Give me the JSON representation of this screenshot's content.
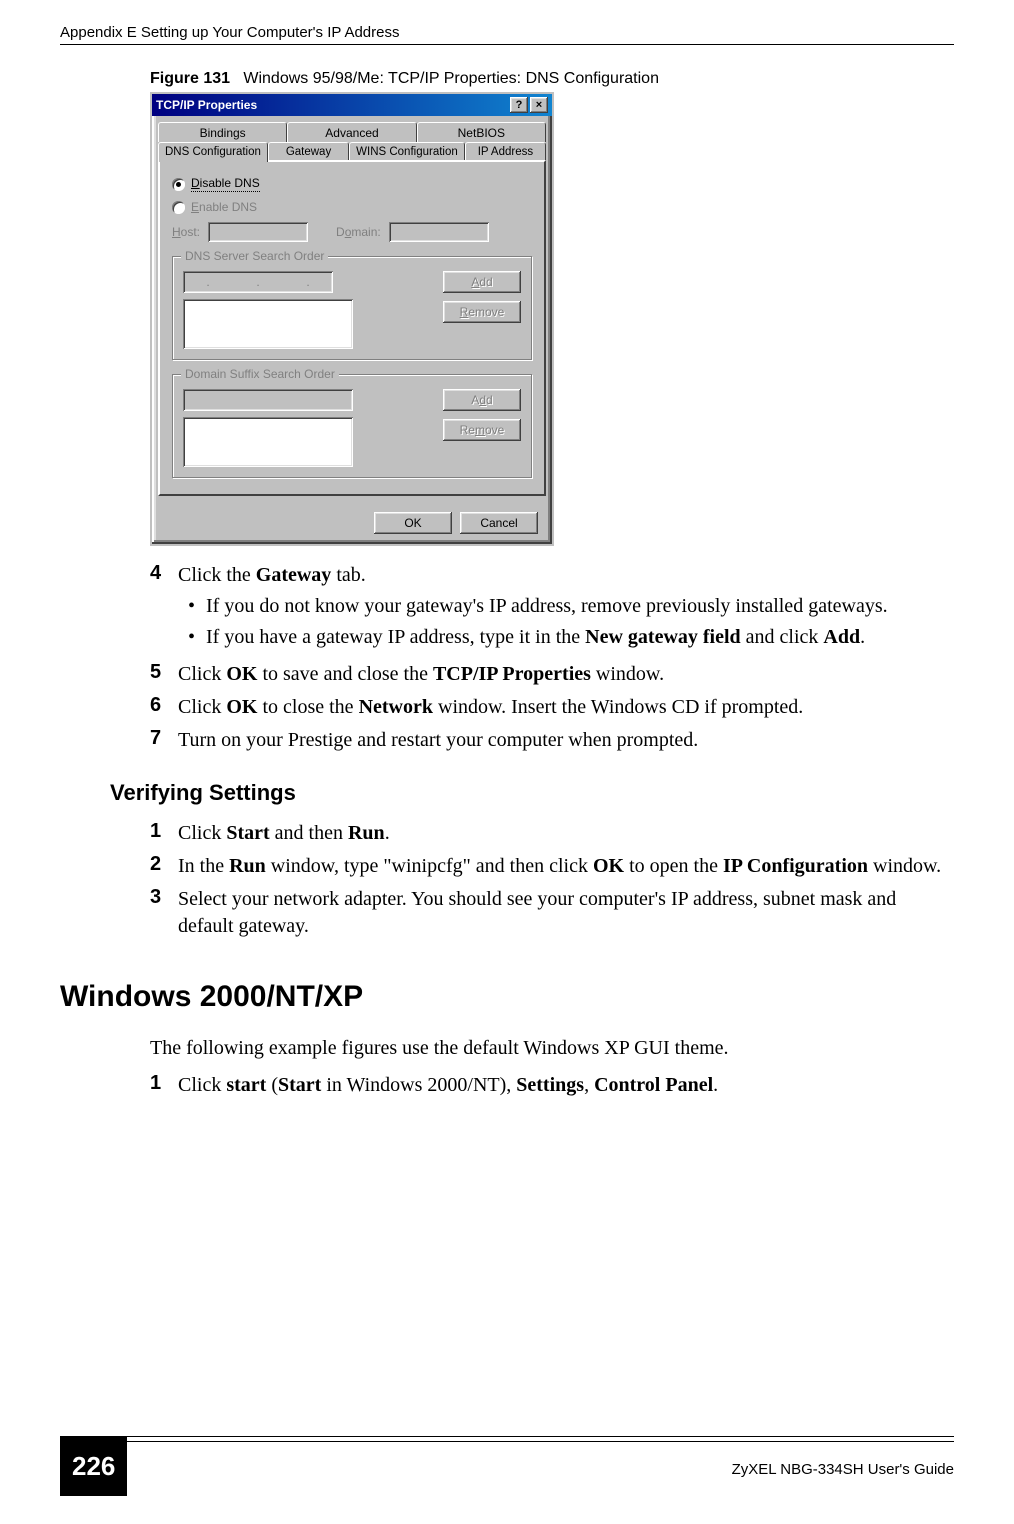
{
  "header": {
    "title": "Appendix E Setting up Your Computer's IP Address"
  },
  "figure": {
    "label": "Figure 131",
    "caption": "Windows 95/98/Me: TCP/IP Properties: DNS Configuration"
  },
  "dialog": {
    "title": "TCP/IP Properties",
    "help_glyph": "?",
    "close_glyph": "×",
    "tabs_row1": [
      "Bindings",
      "Advanced",
      "NetBIOS"
    ],
    "tabs_row2": [
      "DNS Configuration",
      "Gateway",
      "WINS Configuration",
      "IP Address"
    ],
    "active_tab": "DNS Configuration",
    "radio_disable": "Disable DNS",
    "radio_enable": "Enable DNS",
    "host_label": "Host:",
    "domain_label": "Domain:",
    "group_dns": "DNS Server Search Order",
    "group_suffix": "Domain Suffix Search Order",
    "btn_add": "Add",
    "btn_remove": "Remove",
    "btn_ok": "OK",
    "btn_cancel": "Cancel"
  },
  "steps_a": {
    "s4": "Click the ",
    "s4_b": "Gateway",
    "s4_end": " tab.",
    "s4_sub1": "If you do not know your gateway's IP address, remove previously installed gateways.",
    "s4_sub2a": "If you have a gateway IP address, type it in the ",
    "s4_sub2b": "New gateway field",
    "s4_sub2c": " and click ",
    "s4_sub2d": "Add",
    "s4_sub2e": ".",
    "s5a": "Click ",
    "s5b": "OK",
    "s5c": " to save and close the ",
    "s5d": "TCP/IP Properties",
    "s5e": " window.",
    "s6a": "Click ",
    "s6b": "OK",
    "s6c": " to close the ",
    "s6d": "Network",
    "s6e": " window. Insert the Windows CD if prompted.",
    "s7": "Turn on your Prestige and restart your computer when prompted."
  },
  "verify_heading": "Verifying Settings",
  "steps_b": {
    "s1a": "Click ",
    "s1b": "Start",
    "s1c": " and then ",
    "s1d": "Run",
    "s1e": ".",
    "s2a": "In the ",
    "s2b": "Run",
    "s2c": " window, type \"winipcfg\" and then click ",
    "s2d": "OK",
    "s2e": " to open the ",
    "s2f": "IP Configuration",
    "s2g": " window.",
    "s3": "Select your network adapter. You should see your computer's IP address, subnet mask and default gateway."
  },
  "section_heading": "Windows 2000/NT/XP",
  "section_para": "The following example figures use the default Windows XP GUI theme.",
  "steps_c": {
    "s1a": "Click ",
    "s1b": "start",
    "s1c": " (",
    "s1d": "Start",
    "s1e": " in Windows 2000/NT), ",
    "s1f": "Settings",
    "s1g": ", ",
    "s1h": "Control Panel",
    "s1i": "."
  },
  "footer": {
    "page": "226",
    "guide": "ZyXEL NBG-334SH User's Guide"
  }
}
